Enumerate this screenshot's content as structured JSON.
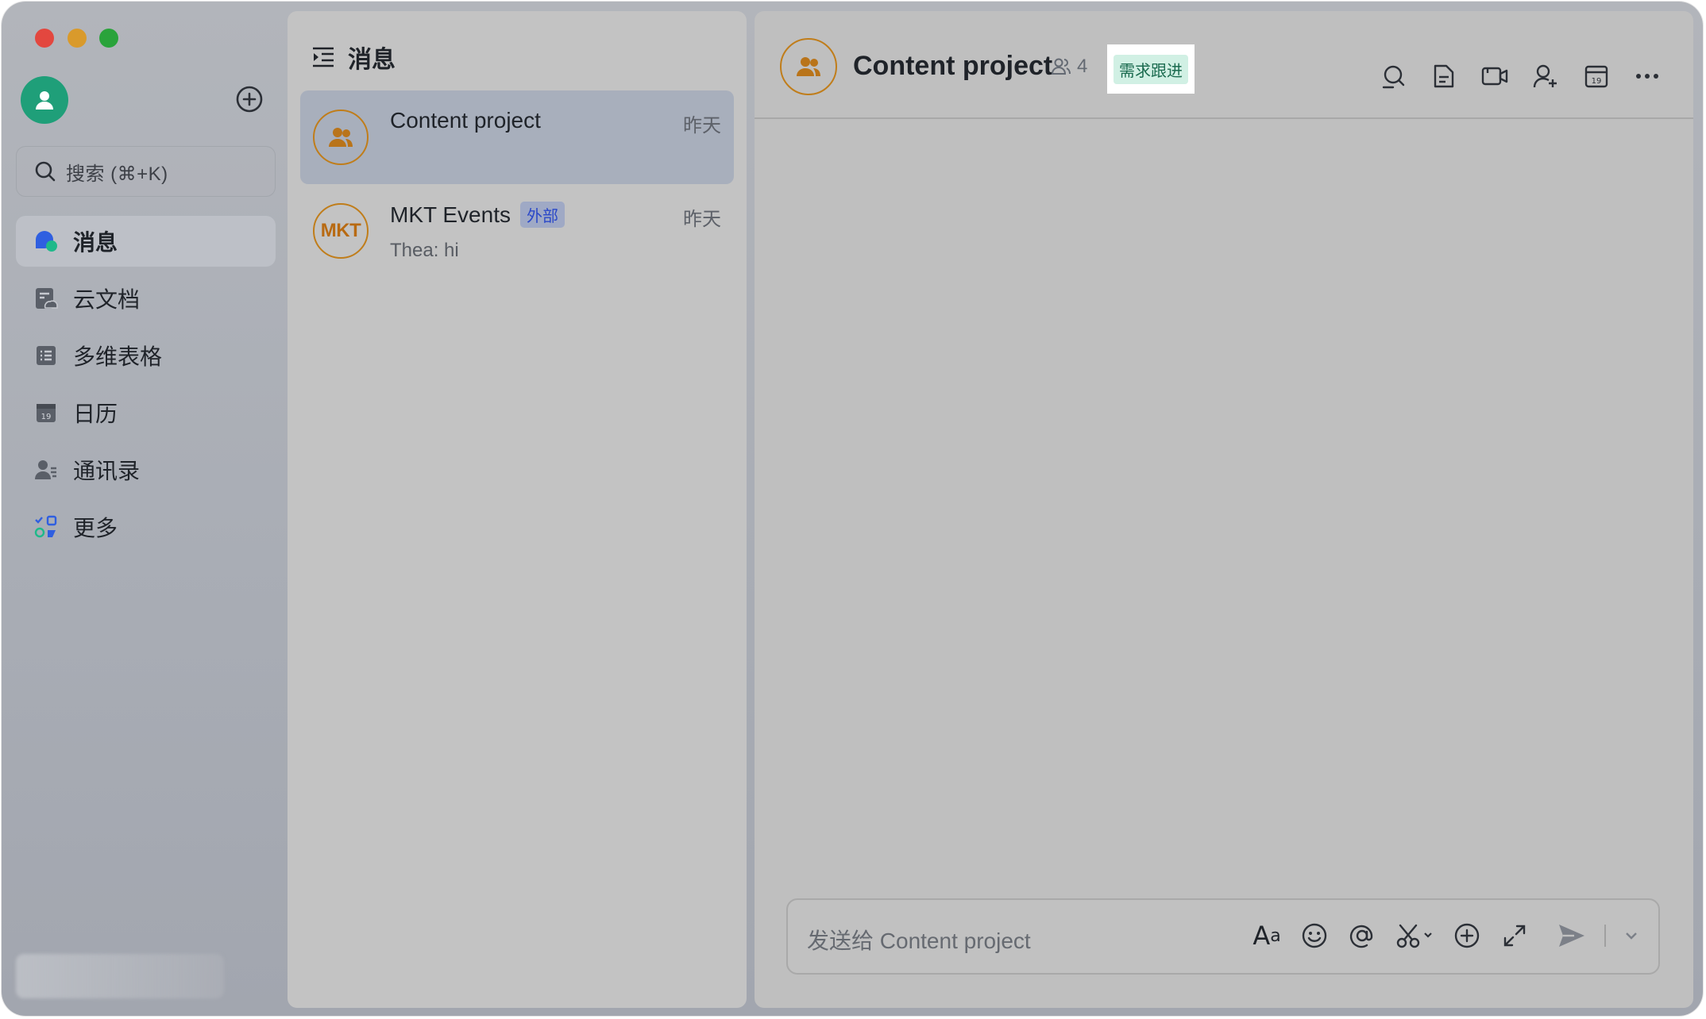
{
  "colors": {
    "accent_green": "#1f9f79",
    "group_avatar_border": "#c07d1a",
    "active_item_bg": "#a8afbc",
    "external_tag_text": "#2a48c8",
    "requirement_tag_text": "#1b6b4f"
  },
  "sidebar": {
    "search_placeholder": "搜索 (⌘+K)",
    "items": [
      {
        "label": "消息",
        "icon": "chat-bubble-icon",
        "active": true
      },
      {
        "label": "云文档",
        "icon": "cloud-doc-icon",
        "active": false
      },
      {
        "label": "多维表格",
        "icon": "table-icon",
        "active": false
      },
      {
        "label": "日历",
        "icon": "calendar-icon",
        "active": false
      },
      {
        "label": "通讯录",
        "icon": "contacts-icon",
        "active": false
      },
      {
        "label": "更多",
        "icon": "apps-icon",
        "active": false
      }
    ]
  },
  "list": {
    "title": "消息",
    "conversations": [
      {
        "name": "Content project",
        "time": "昨天",
        "preview": "",
        "avatar": "group-icon",
        "active": true
      },
      {
        "name": "MKT Events",
        "tag": "外部",
        "time": "昨天",
        "preview": "Thea: hi",
        "avatar_text": "MKT",
        "active": false
      }
    ]
  },
  "chat": {
    "title": "Content project",
    "member_count": "4",
    "tag": "需求跟进",
    "header_icons": [
      "search-chat-icon",
      "document-icon",
      "video-call-icon",
      "add-member-icon",
      "calendar-icon",
      "more-icon"
    ],
    "composer": {
      "placeholder": "发送给 Content project",
      "format_label": "Aa"
    }
  }
}
